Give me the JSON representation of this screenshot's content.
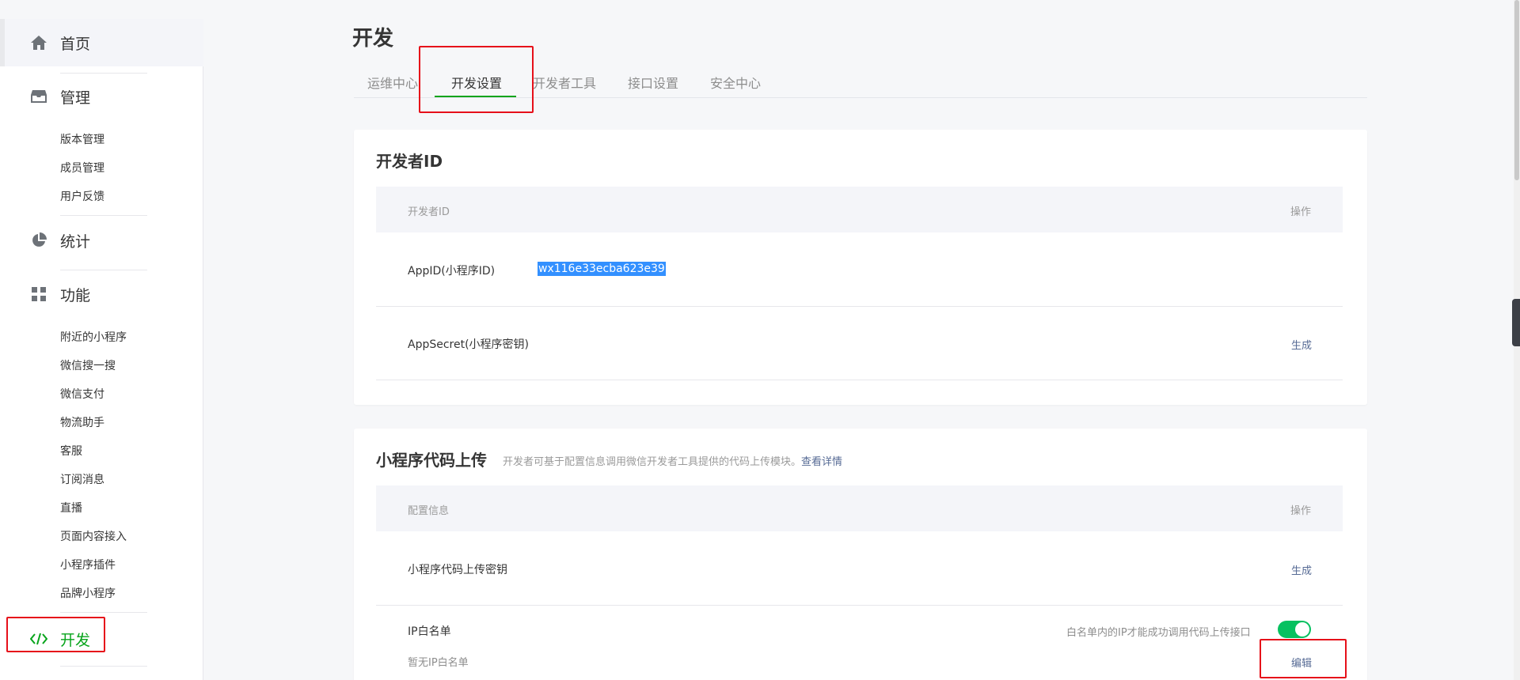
{
  "sidebar": {
    "home": "首页",
    "manage": {
      "label": "管理",
      "items": [
        "版本管理",
        "成员管理",
        "用户反馈"
      ]
    },
    "stats": "统计",
    "features": {
      "label": "功能",
      "items": [
        "附近的小程序",
        "微信搜一搜",
        "微信支付",
        "物流助手",
        "客服",
        "订阅消息",
        "直播",
        "页面内容接入",
        "小程序插件",
        "品牌小程序"
      ]
    },
    "develop": "开发"
  },
  "page": {
    "title": "开发",
    "tabs": [
      "运维中心",
      "开发设置",
      "开发者工具",
      "接口设置",
      "安全中心"
    ],
    "active_tab": "开发设置"
  },
  "developer_id": {
    "title": "开发者ID",
    "header_left": "开发者ID",
    "header_right": "操作",
    "appid_label": "AppID(小程序ID)",
    "appid_value": "wx116e33ecba623e39",
    "appsecret_label": "AppSecret(小程序密钥)",
    "appsecret_action": "生成"
  },
  "code_upload": {
    "title": "小程序代码上传",
    "desc": "开发者可基于配置信息调用微信开发者工具提供的代码上传模块。",
    "desc_link": "查看详情",
    "header_left": "配置信息",
    "header_right": "操作",
    "upload_key_label": "小程序代码上传密钥",
    "upload_key_action": "生成",
    "ip_whitelist_label": "IP白名单",
    "ip_whitelist_hint": "白名单内的IP才能成功调用代码上传接口",
    "ip_whitelist_empty": "暂无IP白名单",
    "ip_whitelist_action": "编辑"
  },
  "colors": {
    "accent": "#07a41b",
    "link": "#576b95",
    "highlight": "#e6101a"
  }
}
